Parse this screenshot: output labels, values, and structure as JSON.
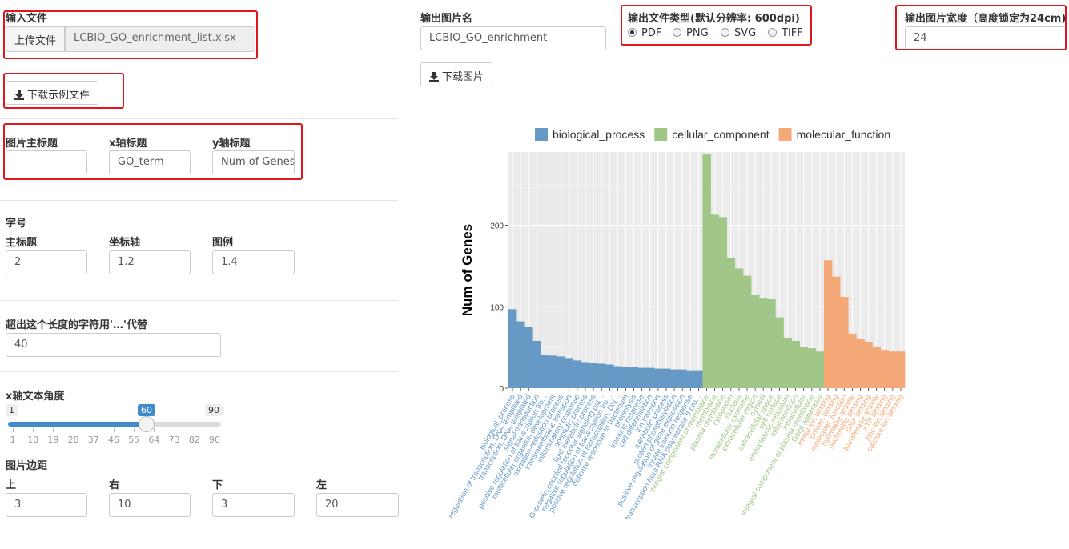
{
  "upload": {
    "label": "输入文件",
    "button": "上传文件",
    "filename": "LCBIO_GO_enrichment_list.xlsx",
    "download_example": "下载示例文件"
  },
  "titles": {
    "main_label": "图片主标题",
    "main_value": "",
    "x_label": "x轴标题",
    "x_value": "GO_term",
    "y_label": "y轴标题",
    "y_value": "Num of Genes"
  },
  "fontsize": {
    "section": "字号",
    "main_label": "主标题",
    "main_value": "2",
    "axis_label": "坐标轴",
    "axis_value": "1.2",
    "legend_label": "图例",
    "legend_value": "1.4"
  },
  "truncate": {
    "label": "超出这个长度的字符用'…'代替",
    "value": "40"
  },
  "angle": {
    "label": "x轴文本角度",
    "min": "1",
    "max": "90",
    "value": 60,
    "ticks": [
      "1",
      "10",
      "19",
      "28",
      "37",
      "46",
      "55",
      "64",
      "73",
      "82",
      "90"
    ]
  },
  "margins": {
    "section": "图片边距",
    "top_label": "上",
    "top_value": "3",
    "right_label": "右",
    "right_value": "10",
    "bottom_label": "下",
    "bottom_value": "3",
    "left_label": "左",
    "left_value": "20"
  },
  "output": {
    "name_label": "输出图片名",
    "name_value": "LCBIO_GO_enrichment",
    "download": "下载图片",
    "type_label": "输出文件类型(默认分辨率: 600dpi)",
    "types": [
      "PDF",
      "PNG",
      "SVG",
      "TIFF"
    ],
    "selected_type": "PDF",
    "width_label": "输出图片宽度（高度锁定为24cm)",
    "width_value": "24"
  },
  "colors": {
    "biological_process": "#6699c6",
    "cellular_component": "#a1c788",
    "molecular_function": "#f4a878",
    "highlight": "#e0161c"
  },
  "chart_data": {
    "type": "bar",
    "ylabel": "Num of Genes",
    "yticks": [
      "0",
      "100",
      "200"
    ],
    "ylim": [
      0,
      290
    ],
    "legend_position": "top",
    "series": [
      {
        "name": "biological_process",
        "categories": [
          "biological_process",
          "regulation of transcription, DNA-templated",
          "transcription, DNA-templated",
          "signal transduction",
          "positive regulation of transcription fro...",
          "multicellular organism development",
          "oxidation-reduction process",
          "transmembrane transport",
          "inflammatory response",
          "apoptotic process",
          "lipid metabolic process",
          "G-protein coupled receptor signaling pat...",
          "negative regulation of transcription fro...",
          "positive regulation of transcription, DN...",
          "defense response to bacterium",
          "proteolysis",
          "immune response",
          "cell differentiation",
          "ion transport",
          "metabolic process",
          "protein phosphorylation",
          "positive regulation of gene expression",
          "innate immune response",
          "transcription from RNA polymerase II pro..."
        ],
        "values": [
          97,
          82,
          75,
          58,
          41,
          40,
          39,
          37,
          34,
          32,
          31,
          30,
          29,
          27,
          26,
          26,
          25,
          25,
          24,
          24,
          23,
          23,
          22,
          22
        ]
      },
      {
        "name": "cellular_component",
        "categories": [
          "integral component of membrane",
          "membrane",
          "plasma membrane",
          "cytoplasm",
          "nucleus",
          "extracellular exosome",
          "extracellular region",
          "cytosol",
          "extracellular space",
          "cell surface",
          "endoplasmic reticulum",
          "mitochondrion",
          "intracellular",
          "integral component of plasma membrane",
          "Golgi apparatus"
        ],
        "values": [
          287,
          213,
          210,
          160,
          147,
          138,
          114,
          111,
          110,
          87,
          62,
          58,
          51,
          49,
          45
        ]
      },
      {
        "name": "molecular_function",
        "categories": [
          "metal ion binding",
          "protein binding",
          "molecular_function",
          "hydrolase activity",
          "nucleotide binding",
          "DNA binding",
          "transferase activity",
          "ATP binding",
          "zinc ion binding",
          "calcium ion binding"
        ],
        "values": [
          157,
          137,
          112,
          67,
          61,
          57,
          51,
          47,
          45,
          45
        ]
      }
    ]
  }
}
